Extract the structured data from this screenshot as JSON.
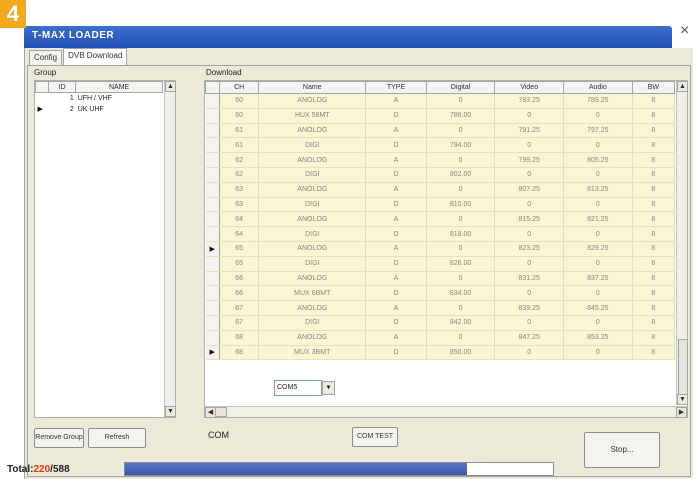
{
  "badge": "4",
  "window": {
    "title": "T-MAX LOADER",
    "close_glyph": "×"
  },
  "tabs": [
    {
      "label": "Config",
      "active": false
    },
    {
      "label": "DVB Download",
      "active": true
    }
  ],
  "group": {
    "label": "Group",
    "columns": [
      "ID",
      "NAME"
    ],
    "rows": [
      {
        "id": "1",
        "name": "UFH / VHF"
      },
      {
        "id": "2",
        "name": "UK UHF"
      }
    ],
    "selected_marker": "▶"
  },
  "download": {
    "label": "Download",
    "columns": [
      "CH",
      "Name",
      "TYPE",
      "Digital",
      "Video",
      "Audio",
      "BW"
    ],
    "rows": [
      {
        "ch": "60",
        "name": "ANOLOG",
        "type": "A",
        "digital": "0",
        "video": "783.25",
        "audio": "789.25",
        "bw": "8"
      },
      {
        "ch": "60",
        "name": "HUX 58MT",
        "type": "D",
        "digital": "786.00",
        "video": "0",
        "audio": "0",
        "bw": "8"
      },
      {
        "ch": "61",
        "name": "ANOLOG",
        "type": "A",
        "digital": "0",
        "video": "791.25",
        "audio": "797.25",
        "bw": "8"
      },
      {
        "ch": "61",
        "name": "DIGI",
        "type": "D",
        "digital": "794.00",
        "video": "0",
        "audio": "0",
        "bw": "8"
      },
      {
        "ch": "62",
        "name": "ANOLOG",
        "type": "A",
        "digital": "0",
        "video": "799.25",
        "audio": "805.25",
        "bw": "8"
      },
      {
        "ch": "62",
        "name": "DIGI",
        "type": "D",
        "digital": "802.00",
        "video": "0",
        "audio": "0",
        "bw": "8"
      },
      {
        "ch": "63",
        "name": "ANOLOG",
        "type": "A",
        "digital": "0",
        "video": "807.25",
        "audio": "813.25",
        "bw": "8"
      },
      {
        "ch": "63",
        "name": "DIGI",
        "type": "D",
        "digital": "810.00",
        "video": "0",
        "audio": "0",
        "bw": "8"
      },
      {
        "ch": "64",
        "name": "ANOLOG",
        "type": "A",
        "digital": "0",
        "video": "815.25",
        "audio": "821.25",
        "bw": "8"
      },
      {
        "ch": "64",
        "name": "DIGI",
        "type": "D",
        "digital": "818.00",
        "video": "0",
        "audio": "0",
        "bw": "8"
      },
      {
        "ch": "65",
        "name": "ANOLOG",
        "type": "A",
        "digital": "0",
        "video": "823.25",
        "audio": "829.25",
        "bw": "8"
      },
      {
        "ch": "65",
        "name": "DIGI",
        "type": "D",
        "digital": "826.00",
        "video": "0",
        "audio": "0",
        "bw": "8"
      },
      {
        "ch": "66",
        "name": "ANOLOG",
        "type": "A",
        "digital": "0",
        "video": "831.25",
        "audio": "837.25",
        "bw": "8"
      },
      {
        "ch": "66",
        "name": "MUX 6BMT",
        "type": "D",
        "digital": "834.00",
        "video": "0",
        "audio": "0",
        "bw": "8"
      },
      {
        "ch": "67",
        "name": "ANOLOG",
        "type": "A",
        "digital": "0",
        "video": "839.25",
        "audio": "845.25",
        "bw": "8"
      },
      {
        "ch": "67",
        "name": "DIGI",
        "type": "D",
        "digital": "842.00",
        "video": "0",
        "audio": "0",
        "bw": "8"
      },
      {
        "ch": "68",
        "name": "ANOLOG",
        "type": "A",
        "digital": "0",
        "video": "847.25",
        "audio": "853.25",
        "bw": "8"
      },
      {
        "ch": "68",
        "name": "MUX 3BMT",
        "type": "D",
        "digital": "850.00",
        "video": "0",
        "audio": "0",
        "bw": "8"
      }
    ],
    "current_row_markers": {
      "10": "▶",
      "17": "▶"
    }
  },
  "buttons": {
    "remove_group": "Remove Group",
    "refresh": "Refresh",
    "com_test": "COM TEST",
    "stop": "Stop..."
  },
  "com": {
    "label": "COM",
    "value": "COM5",
    "dropdown_glyph": "▼"
  },
  "total": {
    "prefix": "Total:",
    "current": "220",
    "sep_total": "/588"
  },
  "progress": {
    "fraction": 0.8
  },
  "colors": {
    "title_bar": "#2a5bc1",
    "row_bg": "#faf5d2",
    "total_current": "#e03818",
    "badge": "#f3a91e",
    "progress_fill": "#4660b8"
  }
}
